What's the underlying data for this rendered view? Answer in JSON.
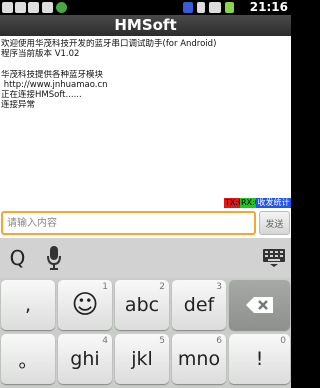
{
  "status_bar": {
    "time": "21:16",
    "icons": [
      "usb-icon",
      "sd-card-icon",
      "android-debug-icon",
      "download-icon",
      "app-icon",
      "signal-icon",
      "bluetooth-icon",
      "wifi-icon",
      "battery-icon"
    ]
  },
  "app": {
    "title": "HMSoft"
  },
  "log": {
    "lines": [
      "欢迎使用华茂科技开发的蓝牙串口调试助手(for Android)",
      "程序当前版本 V1.02",
      "",
      "华茂科技提供各种蓝牙模块",
      " http://www.jnhuamao.cn",
      "正在连接HMSoft......",
      "连接异常"
    ]
  },
  "counters": {
    "tx": "TX:0",
    "rx": "RX:0",
    "stats": "收发统计"
  },
  "input": {
    "placeholder": "请输入内容",
    "send_label": "发送"
  },
  "keyboard": {
    "suggest": {
      "search": "Q"
    },
    "row1": [
      {
        "label": ",",
        "sub": ""
      },
      {
        "label": "☺",
        "sub": "1"
      },
      {
        "label": "abc",
        "sub": "2"
      },
      {
        "label": "def",
        "sub": "3"
      }
    ],
    "row2": [
      {
        "label": "。",
        "sub": ""
      },
      {
        "label": "ghi",
        "sub": "4"
      },
      {
        "label": "jkl",
        "sub": "5"
      },
      {
        "label": "mno",
        "sub": "6"
      },
      {
        "label": "!",
        "sub": "0"
      }
    ]
  }
}
